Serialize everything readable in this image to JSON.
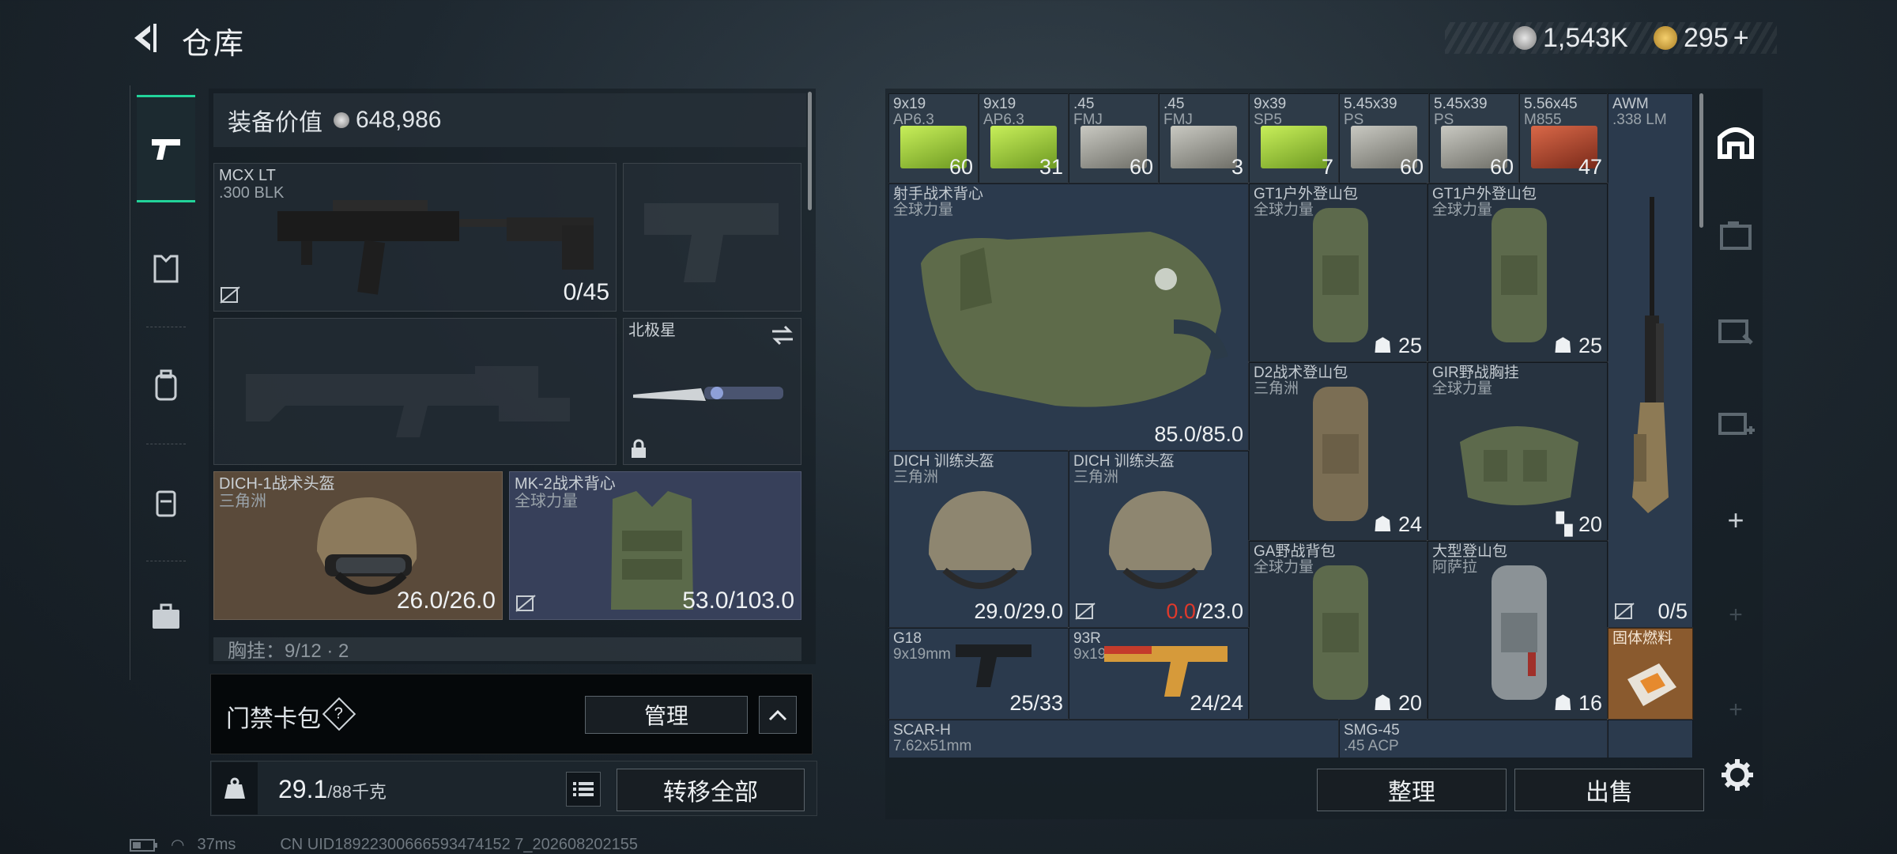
{
  "header": {
    "title": "仓库"
  },
  "currency": [
    {
      "icon": "silver-coin-icon",
      "value": "1,543K"
    },
    {
      "icon": "gold-triangle-icon",
      "value": "295"
    }
  ],
  "left_nav": [
    "pistol-icon",
    "vest-icon",
    "backpack-icon",
    "pouch-icon",
    "briefcase-icon"
  ],
  "equipment": {
    "value_label": "装备价值",
    "value": "648,986",
    "primary_weapon": {
      "name": "MCX LT",
      "ammo": ".300 BLK",
      "count": "0/45"
    },
    "pistol_slot": "",
    "secondary_weapon": "",
    "melee": {
      "name": "北极星"
    },
    "helmet": {
      "name": "DICH-1战术头盔",
      "brand": "三角洲",
      "durability": "26.0/26.0"
    },
    "armor": {
      "name": "MK-2战术背心",
      "brand": "全球力量",
      "durability": "53.0/103.0"
    },
    "vest_summary": "胸挂：9/12 · 2",
    "keycard": {
      "label": "门禁卡包",
      "help": "?",
      "manage": "管理"
    },
    "weight": {
      "current": "29.1",
      "max": "/88千克"
    },
    "transfer_all": "转移全部"
  },
  "stash": {
    "ammo": [
      {
        "n1": "9x19",
        "n2": "AP6.3",
        "q": "60",
        "color": "green"
      },
      {
        "n1": "9x19",
        "n2": "AP6.3",
        "q": "31",
        "color": "green"
      },
      {
        "n1": ".45",
        "n2": "FMJ",
        "q": "60",
        "color": "gray"
      },
      {
        "n1": ".45",
        "n2": "FMJ",
        "q": "3",
        "color": "gray"
      },
      {
        "n1": "9x39",
        "n2": "SP5",
        "q": "7",
        "color": "green"
      },
      {
        "n1": "5.45x39",
        "n2": "PS",
        "q": "60",
        "color": "gray"
      },
      {
        "n1": "5.45x39",
        "n2": "PS",
        "q": "60",
        "color": "gray"
      },
      {
        "n1": "5.56x45",
        "n2": "M855",
        "q": "47",
        "color": "red"
      }
    ],
    "awm": {
      "n1": "AWM",
      "n2": ".338 LM",
      "q": "0/5"
    },
    "sniper_vest": {
      "n1": "射手战术背心",
      "n2": "全球力量",
      "q": "85.0/85.0"
    },
    "gt1_a": {
      "n1": "GT1户外登山包",
      "n2": "全球力量",
      "q": "25"
    },
    "gt1_b": {
      "n1": "GT1户外登山包",
      "n2": "全球力量",
      "q": "25"
    },
    "d2": {
      "n1": "D2战术登山包",
      "n2": "三角洲",
      "q": "24"
    },
    "gir": {
      "n1": "GIR野战胸挂",
      "n2": "全球力量",
      "q": "20"
    },
    "dich_a": {
      "n1": "DICH 训练头盔",
      "n2": "三角洲",
      "q": "29.0/29.0"
    },
    "dich_b": {
      "n1": "DICH 训练头盔",
      "n2": "三角洲",
      "q_damaged": "0.0",
      "q_max": "/23.0"
    },
    "ga": {
      "n1": "GA野战背包",
      "n2": "全球力量",
      "q": "20"
    },
    "big_pack": {
      "n1": "大型登山包",
      "n2": "阿萨拉",
      "q": "16"
    },
    "fuel": {
      "n1": "固体燃料"
    },
    "g18": {
      "n1": "G18",
      "n2": "9x19mm",
      "q": "25/33"
    },
    "g93r": {
      "n1": "93R",
      "n2": "9x19mm",
      "q": "24/24"
    },
    "scar": {
      "n1": "SCAR-H",
      "n2": "7.62x51mm"
    },
    "smg45": {
      "n1": "SMG-45",
      "n2": ".45 ACP"
    }
  },
  "actions": {
    "sort": "整理",
    "sell": "出售"
  },
  "right_tabs": [
    "stash-home-icon",
    "storage-icon",
    "tools-icon",
    "medical-icon",
    "add-icon",
    "add-icon",
    "add-icon"
  ],
  "status": {
    "ping": "37ms",
    "uid": "CN UID18922300666593474152 7_202608202155"
  },
  "colors": {
    "accent": "#22d39a",
    "damaged": "#e0392b"
  }
}
